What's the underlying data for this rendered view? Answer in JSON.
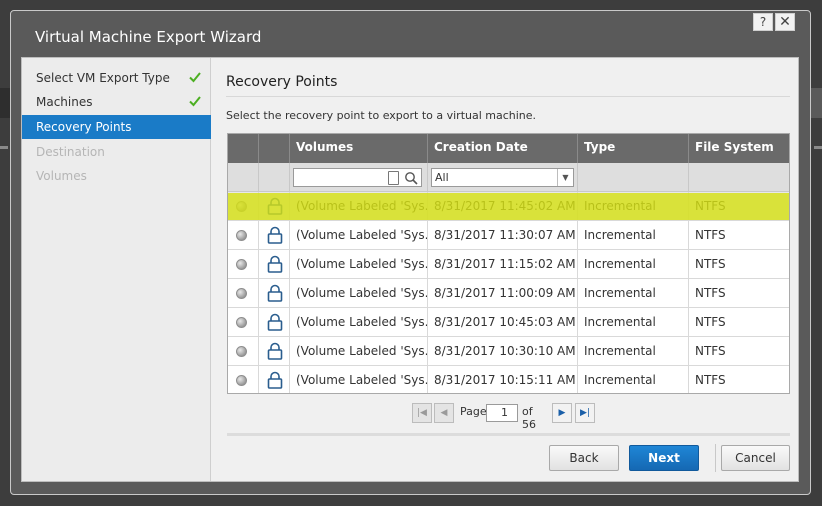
{
  "dialog": {
    "title": "Virtual Machine Export Wizard",
    "help_label": "?",
    "close_label": "✕"
  },
  "nav": {
    "items": [
      {
        "label": "Select VM Export Type",
        "state": "done"
      },
      {
        "label": "Machines",
        "state": "done"
      },
      {
        "label": "Recovery Points",
        "state": "active"
      },
      {
        "label": "Destination",
        "state": "disabled"
      },
      {
        "label": "Volumes",
        "state": "disabled"
      }
    ]
  },
  "content": {
    "title": "Recovery Points",
    "instructions": "Select the recovery point to export to a virtual machine."
  },
  "grid": {
    "columns": [
      "Volumes",
      "Creation Date",
      "Type",
      "File System"
    ],
    "filter": {
      "volumes_value": "",
      "type_value": "All"
    },
    "rows": [
      {
        "volume": "(Volume Labeled 'Sys...",
        "date": "8/31/2017 11:45:02 AM",
        "type": "Incremental",
        "fs": "NTFS"
      },
      {
        "volume": "(Volume Labeled 'Sys...",
        "date": "8/31/2017 11:30:07 AM",
        "type": "Incremental",
        "fs": "NTFS"
      },
      {
        "volume": "(Volume Labeled 'Sys...",
        "date": "8/31/2017 11:15:02 AM",
        "type": "Incremental",
        "fs": "NTFS"
      },
      {
        "volume": "(Volume Labeled 'Sys...",
        "date": "8/31/2017 11:00:09 AM",
        "type": "Incremental",
        "fs": "NTFS"
      },
      {
        "volume": "(Volume Labeled 'Sys...",
        "date": "8/31/2017 10:45:03 AM",
        "type": "Incremental",
        "fs": "NTFS"
      },
      {
        "volume": "(Volume Labeled 'Sys...",
        "date": "8/31/2017 10:30:10 AM",
        "type": "Incremental",
        "fs": "NTFS"
      },
      {
        "volume": "(Volume Labeled 'Sys...",
        "date": "8/31/2017 10:15:11 AM",
        "type": "Incremental",
        "fs": "NTFS"
      }
    ],
    "highlight_color": "#d6e014"
  },
  "pager": {
    "page_label": "Page",
    "current_page": "1",
    "of_label": "of 56"
  },
  "buttons": {
    "back": "Back",
    "next": "Next",
    "cancel": "Cancel"
  },
  "colors": {
    "accent": "#1a7bc7",
    "check": "#4caf22"
  }
}
